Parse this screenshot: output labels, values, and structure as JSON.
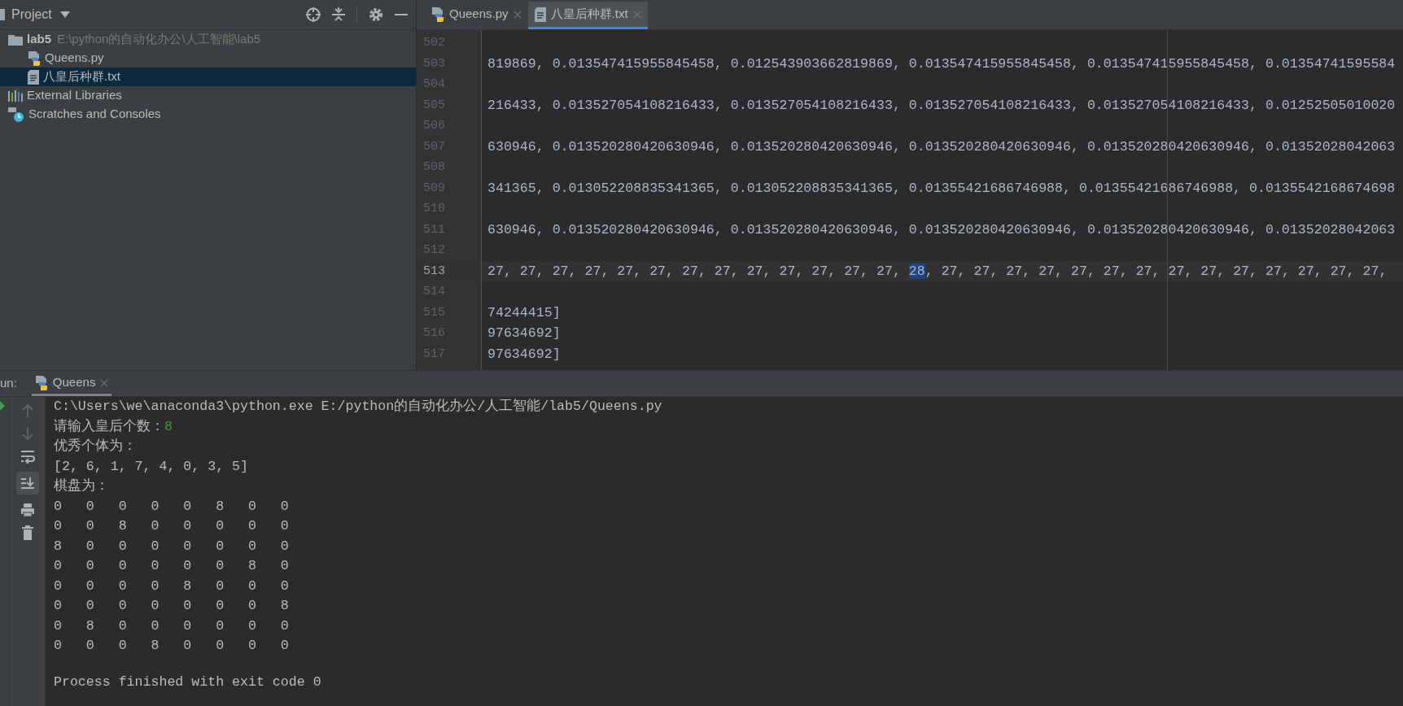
{
  "sidebar": {
    "title": "Project",
    "tree": [
      {
        "label": "lab5",
        "path": "E:\\python的自动化办公\\人工智能\\lab5",
        "kind": "folder",
        "selected": false,
        "children": [
          {
            "label": "Queens.py",
            "kind": "python",
            "selected": false
          },
          {
            "label": "八皇后种群.txt",
            "kind": "text",
            "selected": true
          }
        ]
      },
      {
        "label": "External Libraries",
        "kind": "libraries",
        "selected": false
      },
      {
        "label": "Scratches and Consoles",
        "kind": "scratches",
        "selected": false
      }
    ]
  },
  "editor": {
    "tabs": [
      {
        "label": "Queens.py",
        "kind": "python",
        "selected": false
      },
      {
        "label": "八皇后种群.txt",
        "kind": "text",
        "selected": true
      }
    ],
    "lines": [
      {
        "number": "502",
        "current": false
      },
      {
        "number": "503",
        "current": false,
        "segments": [
          {
            "text": "819869, 0.013547415955845458, 0.012543903662819869, 0.013547415955845458, 0.013547415955845458, 0.01354741595584",
            "selected": false
          }
        ]
      },
      {
        "number": "504",
        "current": false
      },
      {
        "number": "505",
        "current": false,
        "segments": [
          {
            "text": "216433, 0.013527054108216433, 0.013527054108216433, 0.013527054108216433, 0.013527054108216433, 0.01252505010020",
            "selected": false
          }
        ]
      },
      {
        "number": "506",
        "current": false
      },
      {
        "number": "507",
        "current": false,
        "segments": [
          {
            "text": "630946, 0.013520280420630946, 0.013520280420630946, 0.013520280420630946, 0.013520280420630946, 0.01352028042063",
            "selected": false
          }
        ]
      },
      {
        "number": "508",
        "current": false
      },
      {
        "number": "509",
        "current": false,
        "segments": [
          {
            "text": "341365, 0.013052208835341365, 0.013052208835341365, 0.01355421686746988, 0.01355421686746988, 0.0135542168674698",
            "selected": false
          }
        ]
      },
      {
        "number": "510",
        "current": false
      },
      {
        "number": "511",
        "current": false,
        "segments": [
          {
            "text": "630946, 0.013520280420630946, 0.013520280420630946, 0.013520280420630946, 0.013520280420630946, 0.01352028042063",
            "selected": false
          }
        ]
      },
      {
        "number": "512",
        "current": false
      },
      {
        "number": "513",
        "current": true,
        "segments": [
          {
            "text": "27, 27, 27, 27, 27, 27, 27, 27, 27, 27, 27, 27, 27, ",
            "selected": false
          },
          {
            "text": "28",
            "selected": true
          },
          {
            "text": ", 27, 27, 27, 27, 27, 27, 27, 27, 27, 27, 27, 27, 27, 27,",
            "selected": false
          }
        ]
      },
      {
        "number": "514",
        "current": false
      },
      {
        "number": "515",
        "current": false,
        "segments": [
          {
            "text": "74244415]",
            "selected": false
          }
        ]
      },
      {
        "number": "516",
        "current": false,
        "segments": [
          {
            "text": "97634692]",
            "selected": false
          }
        ]
      },
      {
        "number": "517",
        "current": false,
        "segments": [
          {
            "text": "97634692]",
            "selected": false
          }
        ]
      }
    ]
  },
  "run": {
    "label": "un:",
    "tabs": [
      {
        "label": "Queens",
        "selected": true
      }
    ],
    "console": [
      {
        "kind": "output",
        "segments": [
          {
            "kind": "output",
            "text": "C:\\Users\\we\\anaconda3\\python.exe E:/python的自动化办公/人工智能/lab5/Queens.py"
          }
        ]
      },
      {
        "kind": "output",
        "segments": [
          {
            "kind": "output",
            "text": "请输入皇后个数："
          },
          {
            "kind": "input",
            "text": "8"
          }
        ]
      },
      {
        "kind": "output",
        "segments": [
          {
            "kind": "output",
            "text": "优秀个体为："
          }
        ]
      },
      {
        "kind": "output",
        "segments": [
          {
            "kind": "output",
            "text": "[2, 6, 1, 7, 4, 0, 3, 5]"
          }
        ]
      },
      {
        "kind": "output",
        "segments": [
          {
            "kind": "output",
            "text": "棋盘为："
          }
        ]
      },
      {
        "kind": "output",
        "segments": [
          {
            "kind": "output",
            "text": "0   0   0   0   0   8   0   0"
          }
        ]
      },
      {
        "kind": "output",
        "segments": [
          {
            "kind": "output",
            "text": "0   0   8   0   0   0   0   0"
          }
        ]
      },
      {
        "kind": "output",
        "segments": [
          {
            "kind": "output",
            "text": "8   0   0   0   0   0   0   0"
          }
        ]
      },
      {
        "kind": "output",
        "segments": [
          {
            "kind": "output",
            "text": "0   0   0   0   0   0   8   0"
          }
        ]
      },
      {
        "kind": "output",
        "segments": [
          {
            "kind": "output",
            "text": "0   0   0   0   8   0   0   0"
          }
        ]
      },
      {
        "kind": "output",
        "segments": [
          {
            "kind": "output",
            "text": "0   0   0   0   0   0   0   8"
          }
        ]
      },
      {
        "kind": "output",
        "segments": [
          {
            "kind": "output",
            "text": "0   8   0   0   0   0   0   0"
          }
        ]
      },
      {
        "kind": "output",
        "segments": [
          {
            "kind": "output",
            "text": "0   0   0   8   0   0   0   0"
          }
        ]
      },
      {
        "kind": "exit",
        "segments": [
          {
            "kind": "output",
            "text": "Process finished with exit code 0"
          }
        ]
      }
    ]
  }
}
